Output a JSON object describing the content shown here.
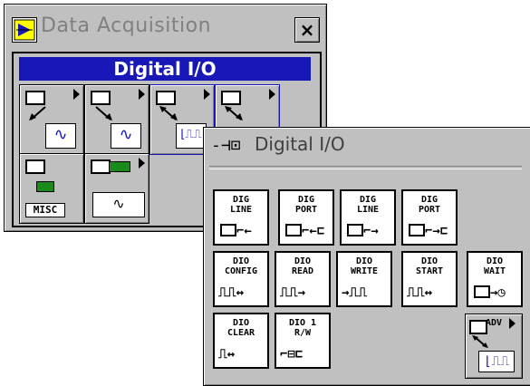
{
  "back_palette": {
    "title": "Data Acquisition",
    "close_label": "×",
    "header": "Digital I/O",
    "tiles": [
      {
        "wave": "∿"
      },
      {
        "wave": "∿"
      },
      {
        "wave": "⌊⎍⎍"
      },
      {
        "wave": ""
      },
      {
        "misc": "MISC"
      },
      {
        "wave": "∿"
      }
    ]
  },
  "front_palette": {
    "title": "Digital I/O",
    "pin_glyph": "-⊣⊡",
    "tiles_row1": [
      {
        "line1": "DIG",
        "line2": "LINE",
        "glyph": "⌐←"
      },
      {
        "line1": "DIG",
        "line2": "PORT",
        "glyph": "⌐←⊏"
      },
      {
        "line1": "DIG",
        "line2": "LINE",
        "glyph": "⌐→"
      },
      {
        "line1": "DIG",
        "line2": "PORT",
        "glyph": "⌐→⊏"
      }
    ],
    "tiles_row2": [
      {
        "line1": "DIO",
        "line2": "CONFIG",
        "glyph": "⎍⎍↔"
      },
      {
        "line1": "DIO",
        "line2": "READ",
        "glyph": "⎍⎍→"
      },
      {
        "line1": "DIO",
        "line2": "WRITE",
        "glyph": "→⎍⎍"
      },
      {
        "line1": "DIO",
        "line2": "START",
        "glyph": "⎍⎍↔"
      },
      {
        "line1": "DIO",
        "line2": "WAIT",
        "glyph": "→◷"
      }
    ],
    "tiles_row3": [
      {
        "line1": "DIO",
        "line2": "CLEAR",
        "glyph": "⎍↔"
      },
      {
        "line1": "DIO 1",
        "line2": "R/W",
        "glyph": "⌐⊟⊏"
      }
    ],
    "adv_label": "ADV",
    "adv_wave": "⌊⎍⎍"
  }
}
